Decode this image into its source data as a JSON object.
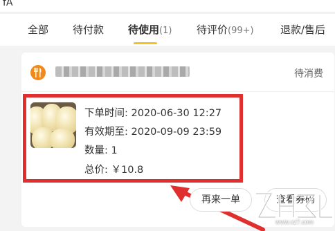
{
  "top_strip": {
    "fragment": "fA"
  },
  "tabs": [
    {
      "label": "全部",
      "count": ""
    },
    {
      "label": "待付款",
      "count": ""
    },
    {
      "label": "待使用",
      "count": "(1)"
    },
    {
      "label": "待评价",
      "count": "(99+)"
    },
    {
      "label": "退款/售后",
      "count": ""
    }
  ],
  "order": {
    "status": "待消费",
    "order_time": "下单时间: 2020-06-30 12:27",
    "valid_until": "有效期至: 2020-09-09 23:59",
    "quantity": "数量: 1",
    "total_price": "总价: ￥10.8"
  },
  "actions": {
    "reorder_label": "再来一单",
    "view_coupon_label": "查看券码"
  },
  "watermark": {
    "text": "www.xz7.com"
  },
  "colors": {
    "accent": "#f5c11c",
    "highlight": "#e02f2f",
    "shop_icon": "#f08a1c"
  }
}
